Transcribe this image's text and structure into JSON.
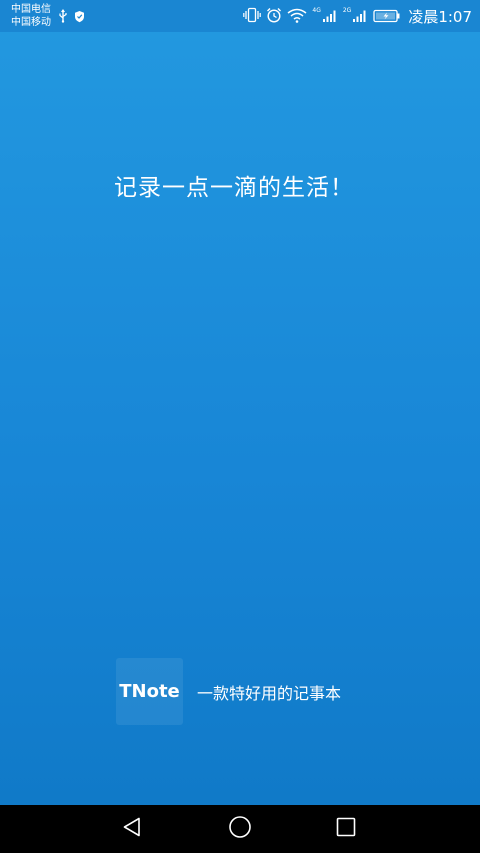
{
  "status_bar": {
    "carrier_1": "中国电信",
    "carrier_2": "中国移动",
    "net_1": "4G",
    "net_2": "2G",
    "time": "凌晨1:07",
    "left_icons": [
      "usb-icon",
      "shield-icon"
    ],
    "right_icons": [
      "vibrate-icon",
      "alarm-icon",
      "wifi-icon",
      "signal-icon",
      "signal-icon",
      "battery-charging-icon"
    ]
  },
  "main": {
    "slogan": "记录一点一滴的生活！",
    "logo_text": "TNote",
    "tagline": "一款特好用的记事本"
  },
  "nav": {
    "icons": [
      "back-icon",
      "home-icon",
      "recent-apps-icon"
    ]
  },
  "colors": {
    "background_top": "#2399e0",
    "background_bottom": "#0f78c6",
    "status_bar": "#1a86d2",
    "nav_bar": "#000000",
    "text": "#ffffff"
  }
}
